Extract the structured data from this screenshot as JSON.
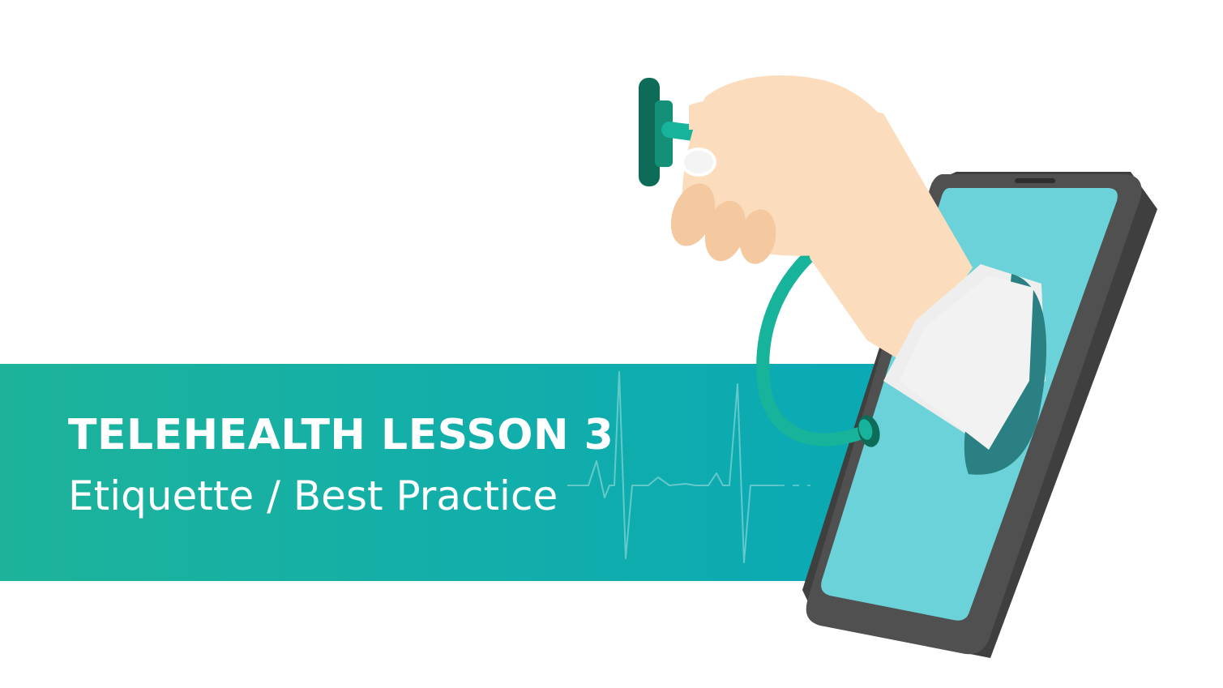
{
  "slide": {
    "title": "TELEHEALTH LESSON 3",
    "subtitle": "Etiquette / Best Practice"
  },
  "illustration": {
    "icons": [
      "hand-icon",
      "stethoscope-icon",
      "smartphone-icon",
      "ecg-line-icon"
    ]
  },
  "colors": {
    "banner_start": "#1db39a",
    "banner_end": "#0aa9b4",
    "phone_frame": "#4a4a4a",
    "phone_screen": "#6ad2d8",
    "stethoscope_tube": "#17b39b",
    "stethoscope_head": "#0d6b57",
    "skin": "#fbdcbc",
    "sleeve": "#eeeeee"
  }
}
